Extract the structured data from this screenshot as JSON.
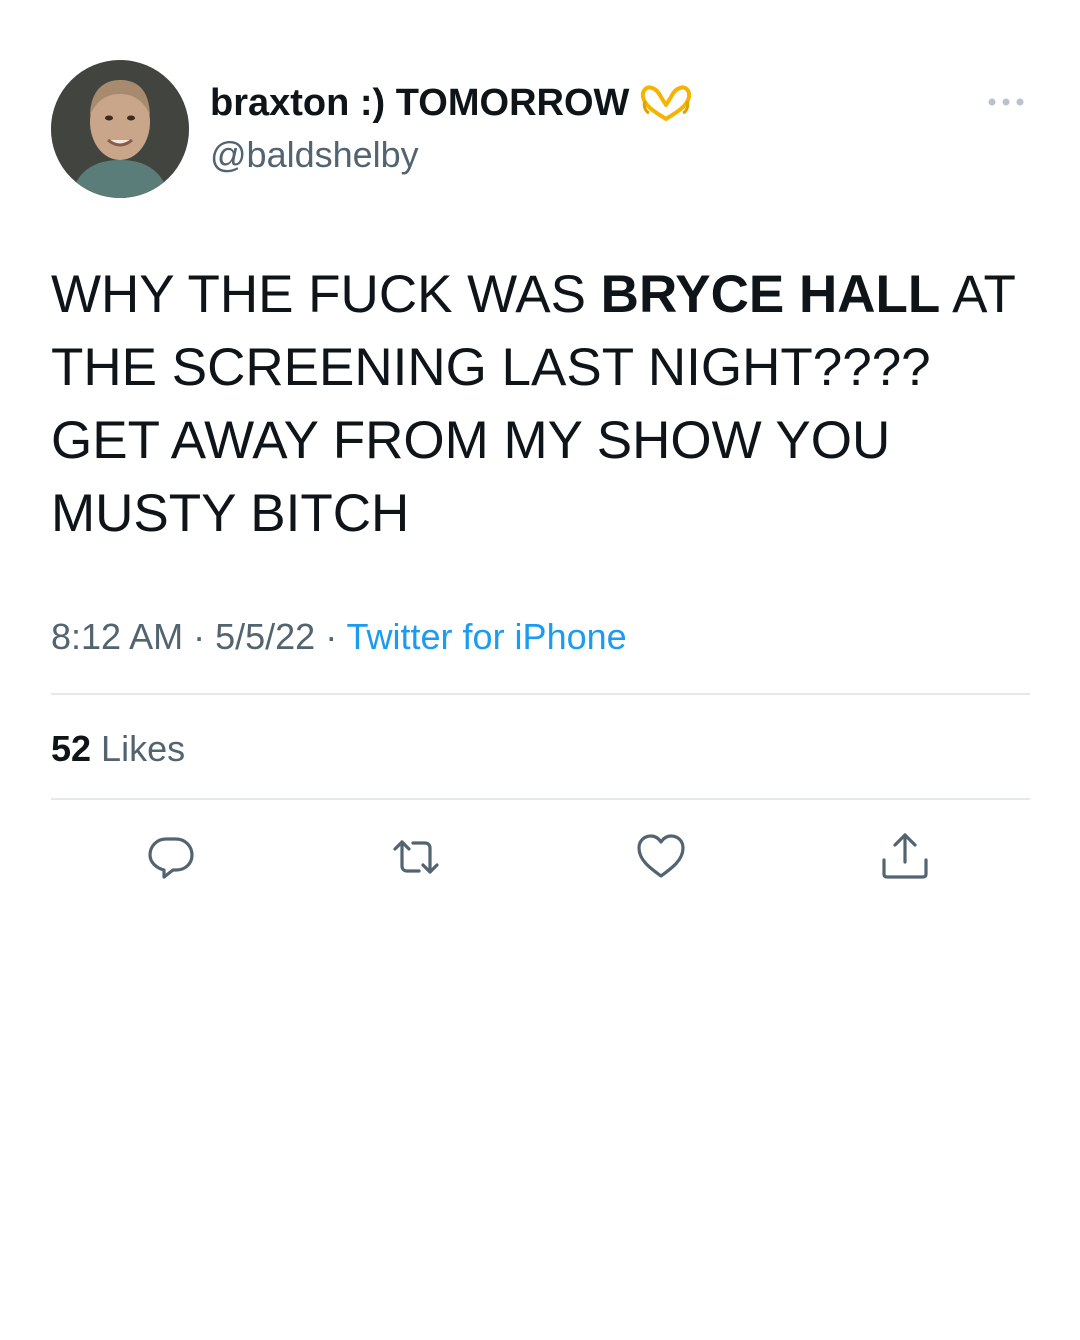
{
  "author": {
    "display_name": "braxton :) TOMORROW",
    "handle": "@baldshelby",
    "emoji_icon": "heart-hands-emoji"
  },
  "tweet": {
    "text_part1": "WHY THE FUCK WAS ",
    "text_bold": "BRYCE HALL",
    "text_part2": " AT THE SCREENING LAST NIGHT???? GET AWAY FROM MY SHOW YOU MUSTY BITCH"
  },
  "meta": {
    "time": "8:12 AM",
    "separator": " · ",
    "date": "5/5/22",
    "source": "Twitter for iPhone"
  },
  "stats": {
    "likes_count": "52",
    "likes_label": " Likes"
  },
  "actions": {
    "reply_icon": "reply-icon",
    "retweet_icon": "retweet-icon",
    "like_icon": "heart-icon",
    "share_icon": "share-icon"
  },
  "colors": {
    "text_primary": "#0f1419",
    "text_secondary": "#536471",
    "link": "#1d9bf0",
    "divider": "#e6e9eb",
    "background": "#ffffff"
  }
}
